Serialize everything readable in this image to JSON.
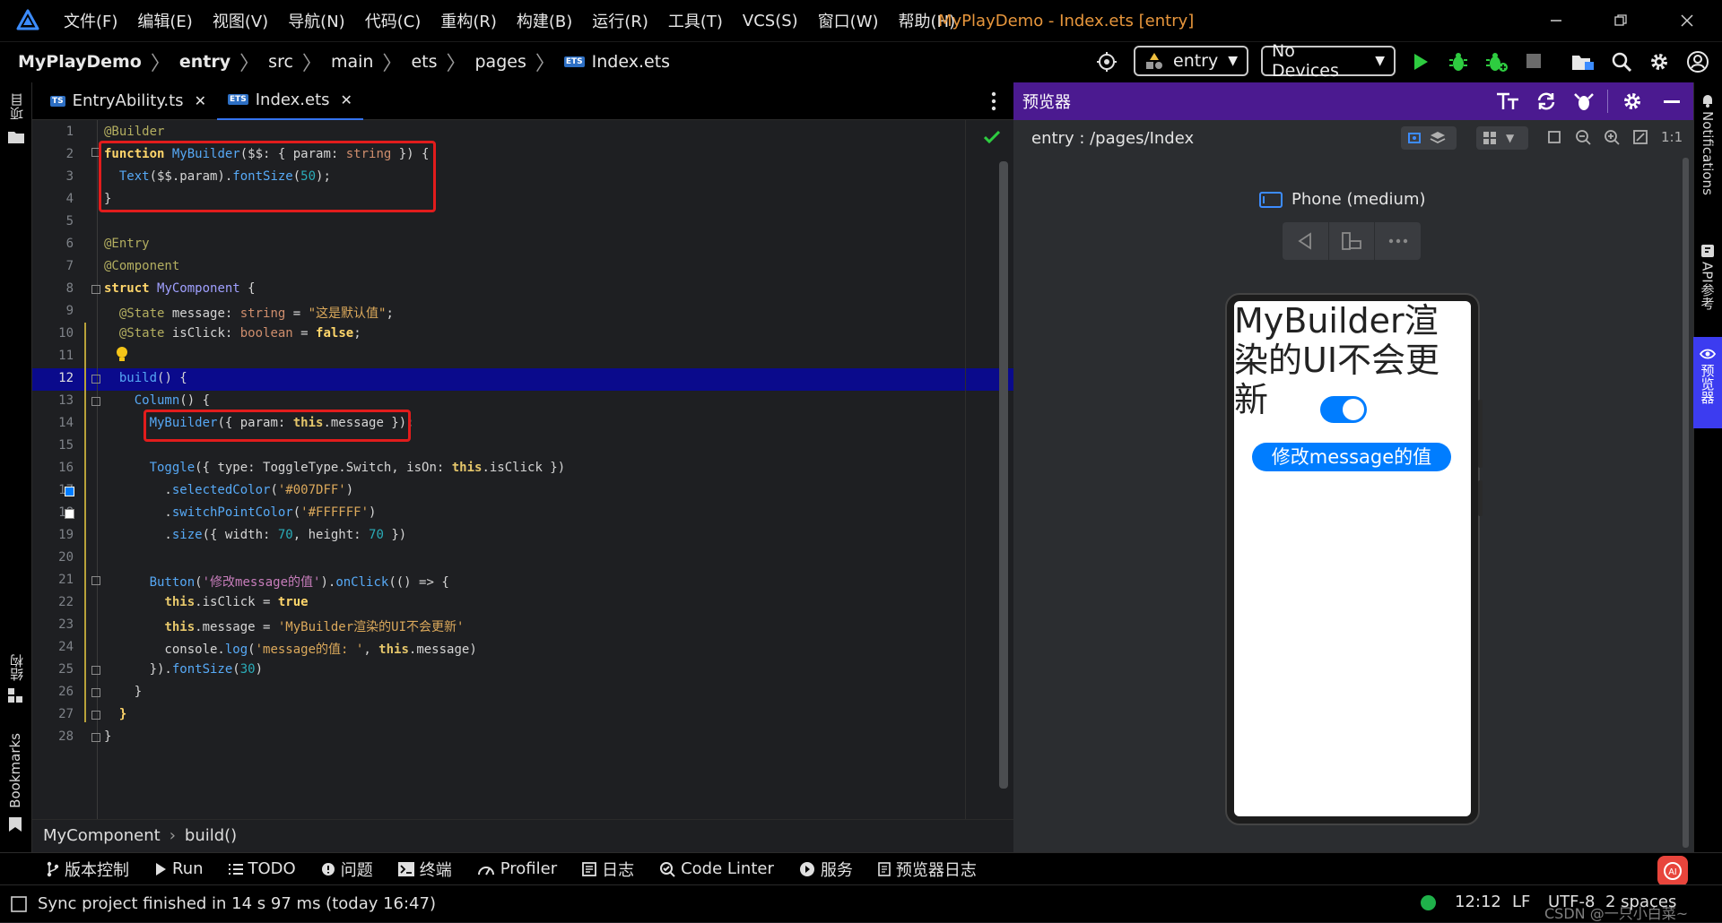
{
  "menu": [
    "文件(F)",
    "编辑(E)",
    "视图(V)",
    "导航(N)",
    "代码(C)",
    "重构(R)",
    "构建(B)",
    "运行(R)",
    "工具(T)",
    "VCS(S)",
    "窗口(W)",
    "帮助(H)"
  ],
  "window_title": "MyPlayDemo - Index.ets [entry]",
  "breadcrumb": [
    "MyPlayDemo",
    "entry",
    "src",
    "main",
    "ets",
    "pages",
    "Index.ets"
  ],
  "toolbar": {
    "module_select": "entry",
    "device_select": "No Devices"
  },
  "left_strip": {
    "project": "项目",
    "structure": "结构",
    "bookmarks": "Bookmarks"
  },
  "tabs": [
    {
      "label": "EntryAbility.ts",
      "badge": "TS"
    },
    {
      "label": "Index.ets",
      "badge": "ETS"
    }
  ],
  "editor": {
    "line_numbers": [
      "1",
      "2",
      "3",
      "4",
      "5",
      "6",
      "7",
      "8",
      "9",
      "10",
      "11",
      "12",
      "13",
      "14",
      "15",
      "16",
      "17",
      "18",
      "19",
      "20",
      "21",
      "22",
      "23",
      "24",
      "25",
      "26",
      "27",
      "28"
    ],
    "swatches": {
      "selected": "#007DFF",
      "point": "#FFFFFF"
    }
  },
  "code_breadcrumb": {
    "component": "MyComponent",
    "method": "build()"
  },
  "preview": {
    "header_title": "预览器",
    "path": "entry : /pages/Index",
    "zoom_label": "1:1",
    "device_label": "Phone (medium)",
    "screen_text": "MyBuilder渲染的UI不会更新",
    "button_label": "修改message的值",
    "accent": "#007DFF"
  },
  "right_strip": {
    "notifications": "Notifications",
    "api": "API参考",
    "previewer": "预览器"
  },
  "bottom_tools": [
    "版本控制",
    "Run",
    "TODO",
    "问题",
    "终端",
    "Profiler",
    "日志",
    "Code Linter",
    "服务",
    "预览器日志"
  ],
  "status": {
    "message": "Sync project finished in 14 s 97 ms (today 16:47)",
    "position": "12:12",
    "line_ending": "LF",
    "encoding": "UTF-8",
    "indent": "2 spaces"
  },
  "watermark": "CSDN @一只小白菜~"
}
